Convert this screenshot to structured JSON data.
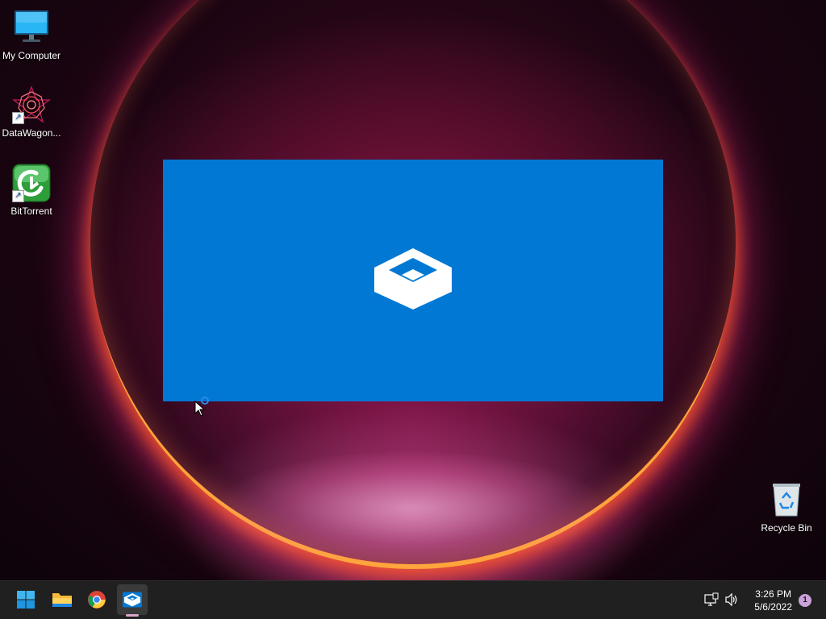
{
  "desktop": {
    "icons": [
      {
        "label": "My Computer",
        "icon": "monitor-icon"
      },
      {
        "label": "DataWagon...",
        "icon": "datawagon-icon"
      },
      {
        "label": "BitTorrent",
        "icon": "bittorrent-icon"
      },
      {
        "label": "Recycle Bin",
        "icon": "recycle-bin-icon"
      }
    ]
  },
  "splash": {
    "app": "Windows Sandbox",
    "background_color": "#0078d4",
    "logo_icon": "sandbox-box-icon"
  },
  "taskbar": {
    "pinned": [
      {
        "name": "start-button",
        "icon": "windows-start-icon"
      },
      {
        "name": "file-explorer",
        "icon": "folder-icon"
      },
      {
        "name": "chrome",
        "icon": "chrome-icon"
      },
      {
        "name": "windows-sandbox",
        "icon": "sandbox-box-icon",
        "active": true
      }
    ],
    "tray": {
      "network_icon": "network-icon",
      "volume_icon": "volume-icon",
      "time": "3:26 PM",
      "date": "5/6/2022",
      "notification_count": "1"
    }
  }
}
